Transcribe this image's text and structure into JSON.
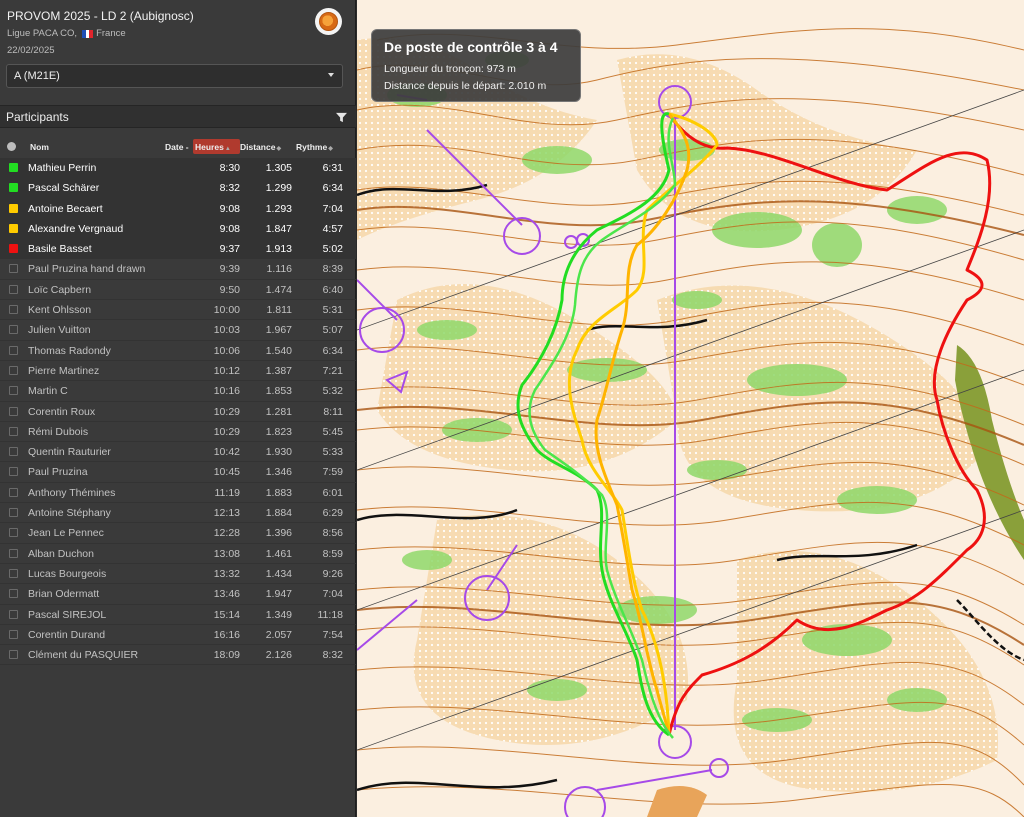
{
  "event": {
    "title": "PROVOM 2025 - LD 2 (Aubignosc)",
    "organizer": "Ligue PACA CO,",
    "country": "France",
    "date": "22/02/2025",
    "logo_icon": "club-logo"
  },
  "class_selector": {
    "value": "A (M21E)"
  },
  "participants_panel": {
    "title": "Participants",
    "filter_icon": "filter-icon",
    "columns": {
      "name": "Nom",
      "date": "Date -",
      "hours": "Heures",
      "distance": "Distance",
      "pace": "Rythme"
    },
    "rows": [
      {
        "name": "Mathieu Perrin",
        "time": "8:30",
        "distance": "1.305",
        "pace": "6:31",
        "selected": true,
        "color": "#22dd22"
      },
      {
        "name": "Pascal Schärer",
        "time": "8:32",
        "distance": "1.299",
        "pace": "6:34",
        "selected": true,
        "color": "#22dd22"
      },
      {
        "name": "Antoine Becaert",
        "time": "9:08",
        "distance": "1.293",
        "pace": "7:04",
        "selected": true,
        "color": "#ffcc00"
      },
      {
        "name": "Alexandre Vergnaud",
        "time": "9:08",
        "distance": "1.847",
        "pace": "4:57",
        "selected": true,
        "color": "#ffcc00"
      },
      {
        "name": "Basile Basset",
        "time": "9:37",
        "distance": "1.913",
        "pace": "5:02",
        "selected": true,
        "color": "#ee1111"
      },
      {
        "name": "Paul Pruzina hand drawn",
        "time": "9:39",
        "distance": "1.116",
        "pace": "8:39",
        "selected": false
      },
      {
        "name": "Loïc Capbern",
        "time": "9:50",
        "distance": "1.474",
        "pace": "6:40",
        "selected": false
      },
      {
        "name": "Kent Ohlsson",
        "time": "10:00",
        "distance": "1.811",
        "pace": "5:31",
        "selected": false
      },
      {
        "name": "Julien Vuitton",
        "time": "10:03",
        "distance": "1.967",
        "pace": "5:07",
        "selected": false
      },
      {
        "name": "Thomas Radondy",
        "time": "10:06",
        "distance": "1.540",
        "pace": "6:34",
        "selected": false
      },
      {
        "name": "Pierre Martinez",
        "time": "10:12",
        "distance": "1.387",
        "pace": "7:21",
        "selected": false
      },
      {
        "name": "Martin C",
        "time": "10:16",
        "distance": "1.853",
        "pace": "5:32",
        "selected": false
      },
      {
        "name": "Corentin Roux",
        "time": "10:29",
        "distance": "1.281",
        "pace": "8:11",
        "selected": false
      },
      {
        "name": "Rémi Dubois",
        "time": "10:29",
        "distance": "1.823",
        "pace": "5:45",
        "selected": false
      },
      {
        "name": "Quentin Rauturier",
        "time": "10:42",
        "distance": "1.930",
        "pace": "5:33",
        "selected": false
      },
      {
        "name": "Paul Pruzina",
        "time": "10:45",
        "distance": "1.346",
        "pace": "7:59",
        "selected": false
      },
      {
        "name": "Anthony Thémines",
        "time": "11:19",
        "distance": "1.883",
        "pace": "6:01",
        "selected": false
      },
      {
        "name": "Antoine Stéphany",
        "time": "12:13",
        "distance": "1.884",
        "pace": "6:29",
        "selected": false
      },
      {
        "name": "Jean Le Pennec",
        "time": "12:28",
        "distance": "1.396",
        "pace": "8:56",
        "selected": false
      },
      {
        "name": "Alban Duchon",
        "time": "13:08",
        "distance": "1.461",
        "pace": "8:59",
        "selected": false
      },
      {
        "name": "Lucas Bourgeois",
        "time": "13:32",
        "distance": "1.434",
        "pace": "9:26",
        "selected": false
      },
      {
        "name": "Brian Odermatt",
        "time": "13:46",
        "distance": "1.947",
        "pace": "7:04",
        "selected": false
      },
      {
        "name": "Pascal SIREJOL",
        "time": "15:14",
        "distance": "1.349",
        "pace": "11:18",
        "selected": false
      },
      {
        "name": "Corentin Durand",
        "time": "16:16",
        "distance": "2.057",
        "pace": "7:54",
        "selected": false
      },
      {
        "name": "Clément du PASQUIER",
        "time": "18:09",
        "distance": "2.126",
        "pace": "8:32",
        "selected": false
      }
    ]
  },
  "map": {
    "info_box": {
      "title": "De poste de contrôle 3 à 4",
      "leg_length": "Longueur du tronçon: 973 m",
      "distance_from_start": "Distance depuis le départ: 2.010 m"
    },
    "colors": {
      "course": "#a855f7",
      "contour": "#c8741a",
      "vegetation": "#6cc94a",
      "open": "#f3b25e"
    }
  }
}
